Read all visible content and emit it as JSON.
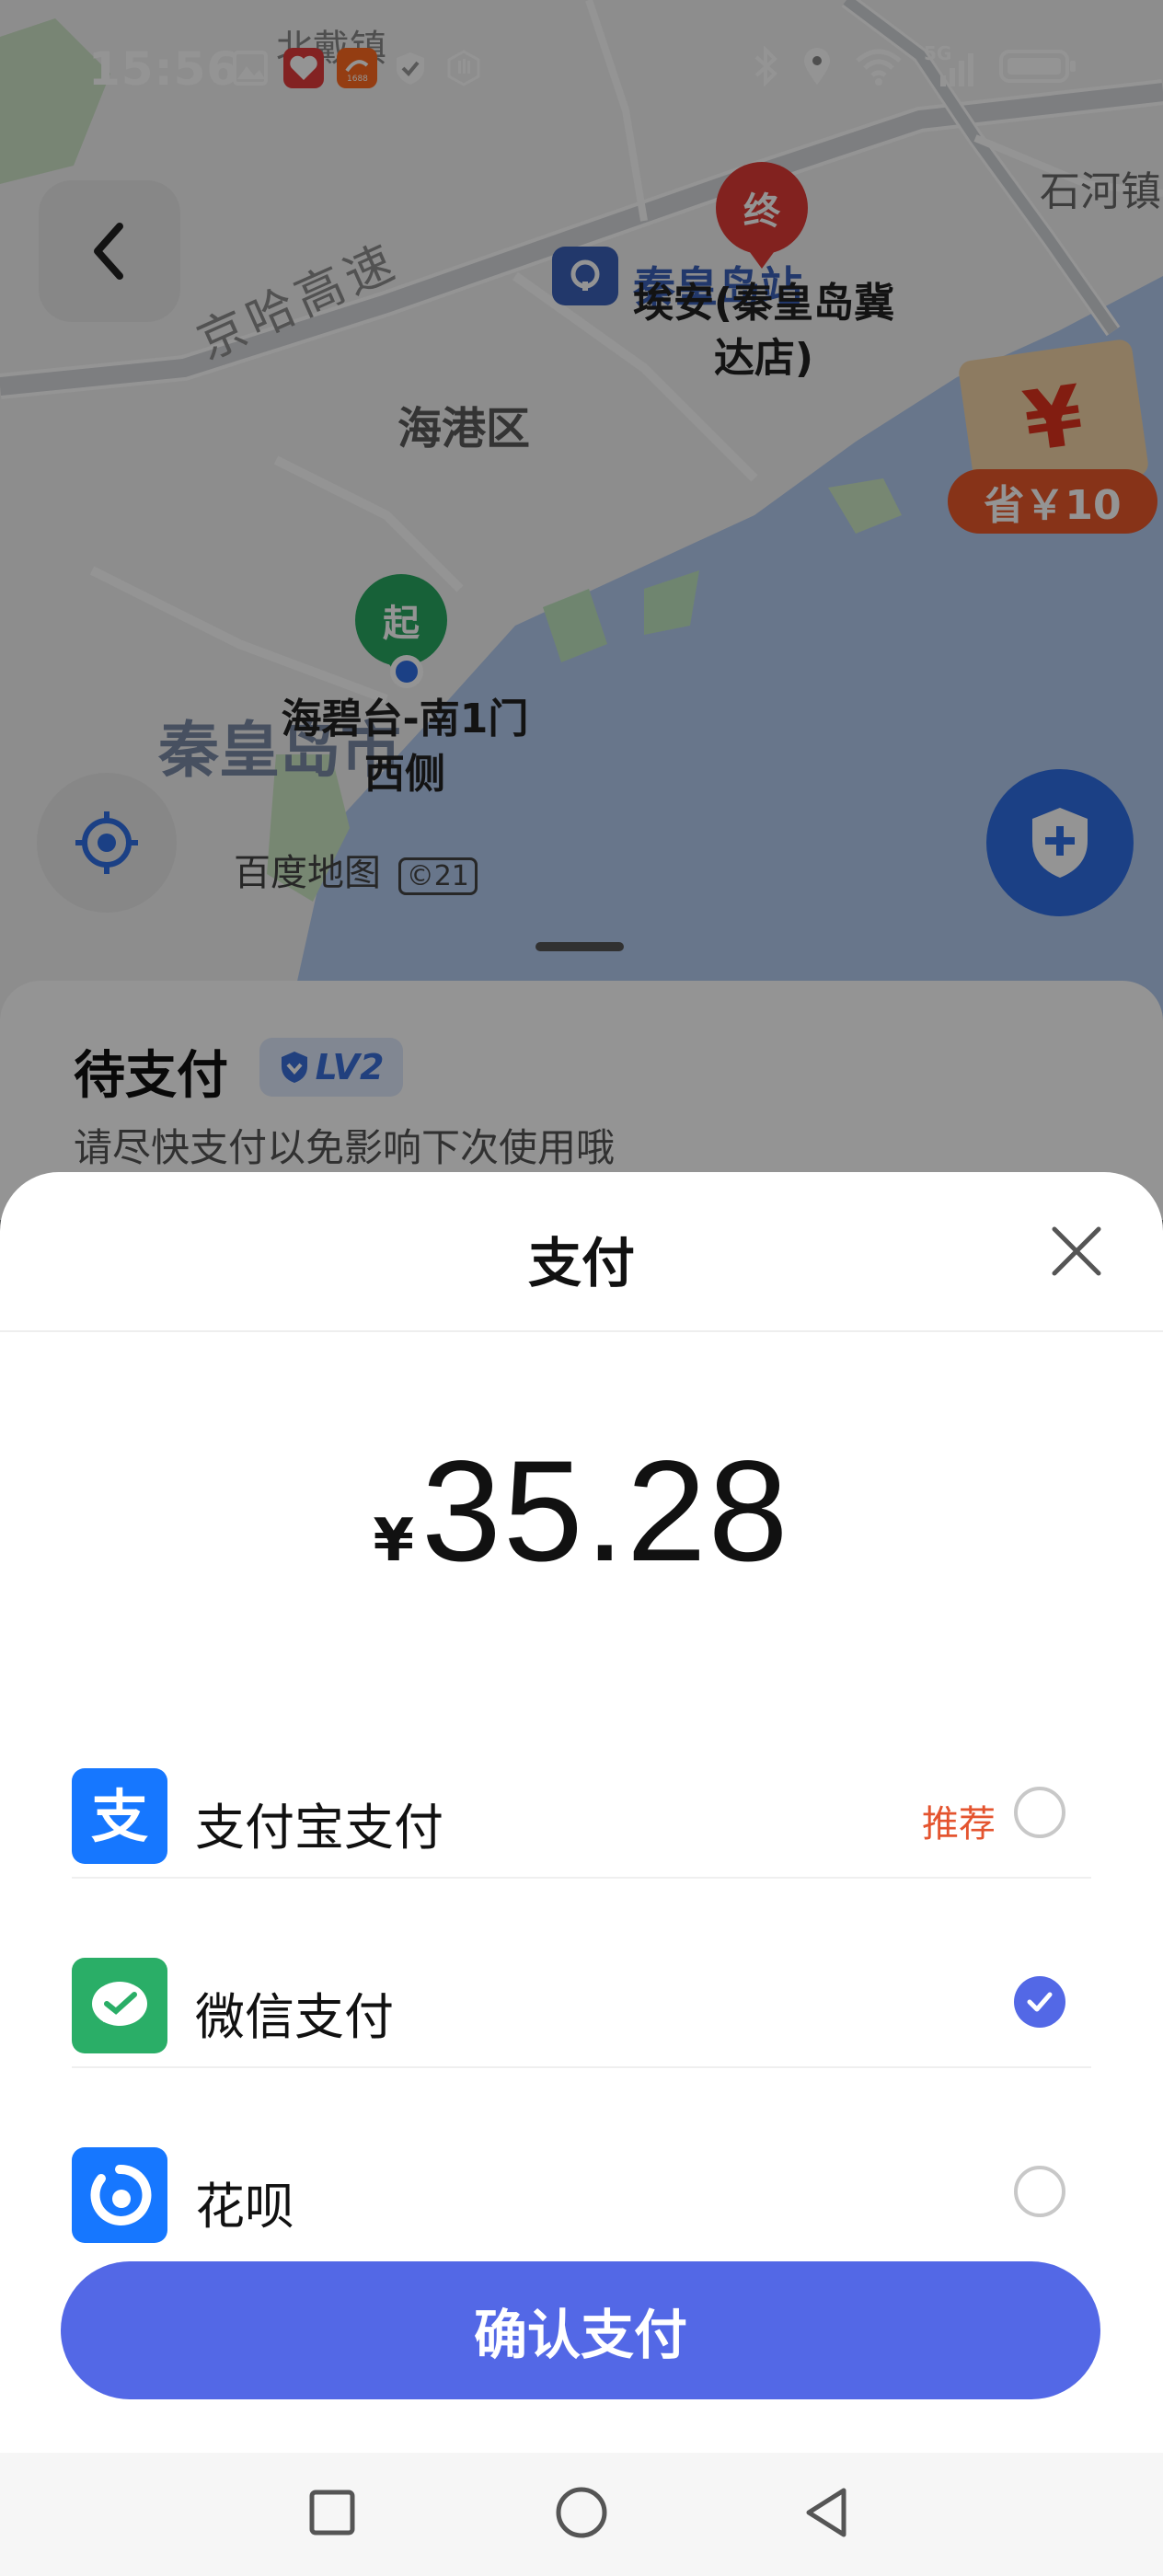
{
  "status_bar": {
    "time": "15:56",
    "left_icons": [
      "gallery-icon",
      "health-app-icon",
      "alibaba-1688-icon",
      "shield-check-icon",
      "hand-icon"
    ],
    "right_icons": [
      "bluetooth-icon",
      "location-icon",
      "wifi-icon",
      "5g-signal-icon",
      "battery-icon"
    ],
    "network": "5G"
  },
  "map": {
    "labels": {
      "road": "京哈高速",
      "district": "海港区",
      "town_right": "石河镇",
      "town_top": "北戴镇",
      "city": "秦皇岛市",
      "station": "秦皇岛站",
      "watermark": "百度地图",
      "watermark_year": "©21"
    },
    "start_pin": {
      "char": "起",
      "place": "海碧台-南1门西侧"
    },
    "end_pin": {
      "char": "终",
      "place": "埃安(秦皇岛冀达店)"
    },
    "promo": {
      "symbol": "¥",
      "text": "省￥10"
    }
  },
  "order": {
    "status": "待支付",
    "level": "LV2",
    "hint": "请尽快支付以免影响下次使用哦"
  },
  "payment": {
    "title": "支付",
    "currency": "¥",
    "amount": "35.28",
    "methods": [
      {
        "label": "支付宝支付",
        "tag": "推荐",
        "selected": false,
        "icon": "alipay-icon",
        "color": "#1677ff"
      },
      {
        "label": "微信支付",
        "tag": "",
        "selected": true,
        "icon": "wechat-pay-icon",
        "color": "#2aae67"
      },
      {
        "label": "花呗",
        "tag": "",
        "selected": false,
        "icon": "huabei-icon",
        "color": "#1677ff"
      }
    ],
    "confirm_label": "确认支付"
  },
  "colors": {
    "accent": "#5368e6",
    "tag_red": "#e4542f"
  },
  "nav_bar": [
    "recent-apps-icon",
    "home-icon",
    "back-icon"
  ]
}
